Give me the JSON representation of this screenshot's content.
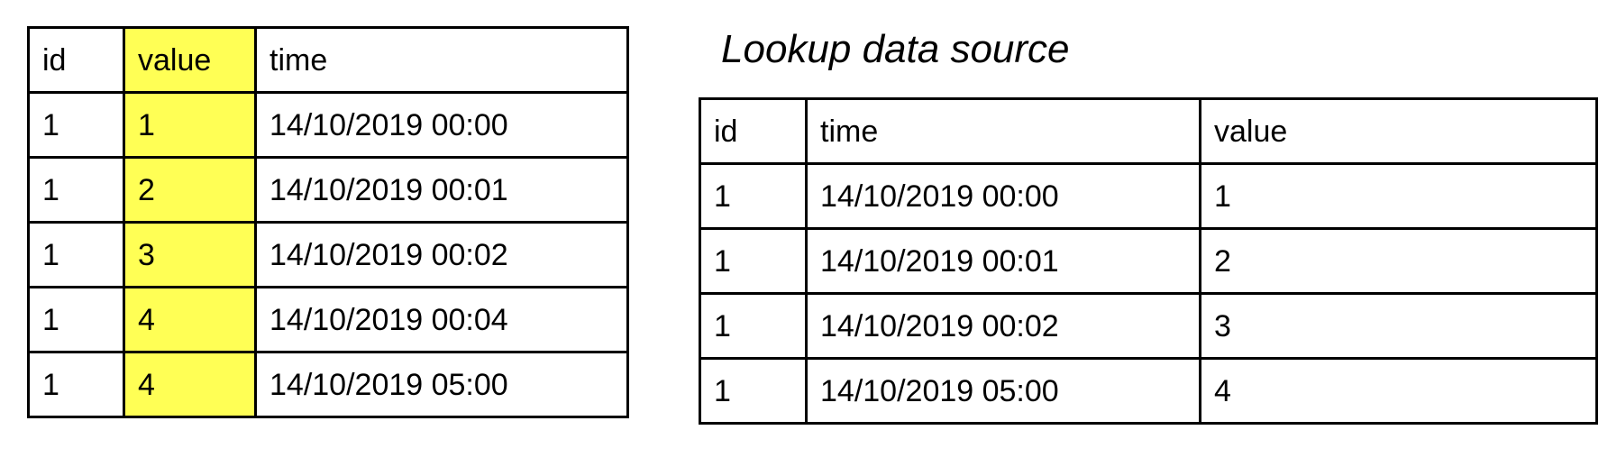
{
  "left_table": {
    "headers": [
      "id",
      "value",
      "time"
    ],
    "rows": [
      [
        "1",
        "1",
        "14/10/2019 00:00"
      ],
      [
        "1",
        "2",
        "14/10/2019 00:01"
      ],
      [
        "1",
        "3",
        "14/10/2019 00:02"
      ],
      [
        "1",
        "4",
        "14/10/2019 00:04"
      ],
      [
        "1",
        "4",
        "14/10/2019 05:00"
      ]
    ],
    "highlight_column": "value",
    "highlight_color": "#ffff55"
  },
  "lookup": {
    "title": "Lookup data source",
    "headers": [
      "id",
      "time",
      "value"
    ],
    "rows": [
      [
        "1",
        "14/10/2019 00:00",
        "1"
      ],
      [
        "1",
        "14/10/2019 00:01",
        "2"
      ],
      [
        "1",
        "14/10/2019 00:02",
        "3"
      ],
      [
        "1",
        "14/10/2019 05:00",
        "4"
      ]
    ]
  }
}
